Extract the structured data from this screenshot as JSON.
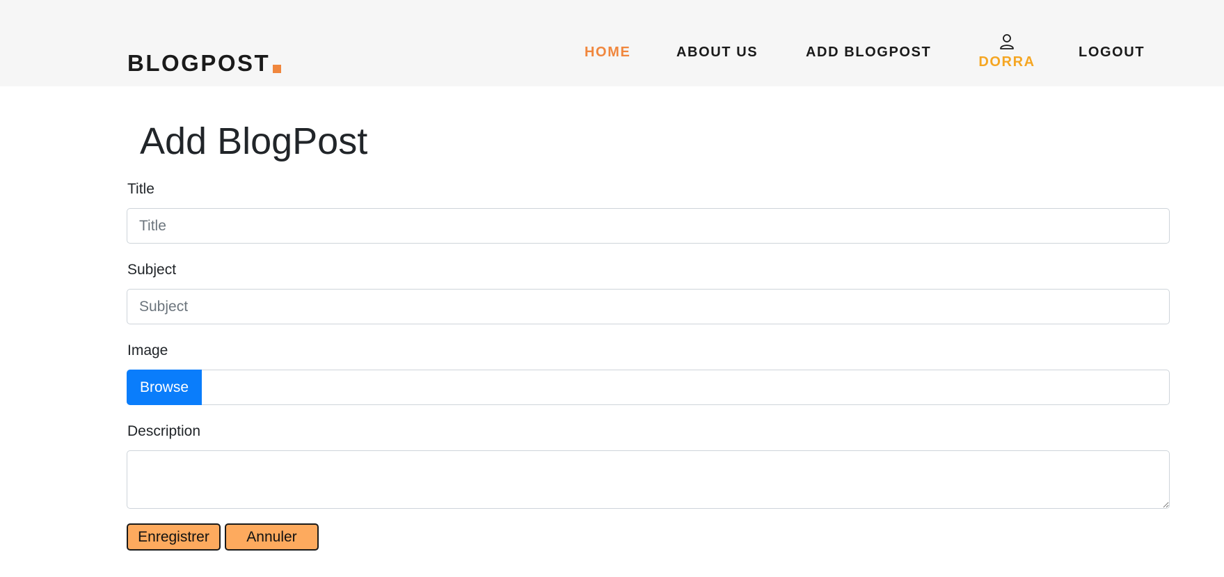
{
  "header": {
    "logo_text": "BLOGPOST",
    "brand_color": "#f0873e",
    "nav": {
      "home": "HOME",
      "about": "ABOUT US",
      "add_blogpost": "ADD BLOGPOST",
      "user_icon": "user-icon",
      "user_name": "DORRA",
      "logout": "LOGOUT"
    }
  },
  "main": {
    "page_title": "Add BlogPost",
    "form": {
      "title_label": "Title",
      "title_value": "",
      "title_placeholder": "Title",
      "subject_label": "Subject",
      "subject_value": "",
      "subject_placeholder": "Subject",
      "image_label": "Image",
      "browse_label": "Browse",
      "description_label": "Description",
      "description_value": "",
      "save_label": "Enregistrer",
      "cancel_label": "Annuler"
    }
  },
  "colors": {
    "active_nav": "#f0873e",
    "user_name": "#f5a623",
    "browse_button": "#0a7dfb",
    "action_button": "#fdaa5e"
  }
}
